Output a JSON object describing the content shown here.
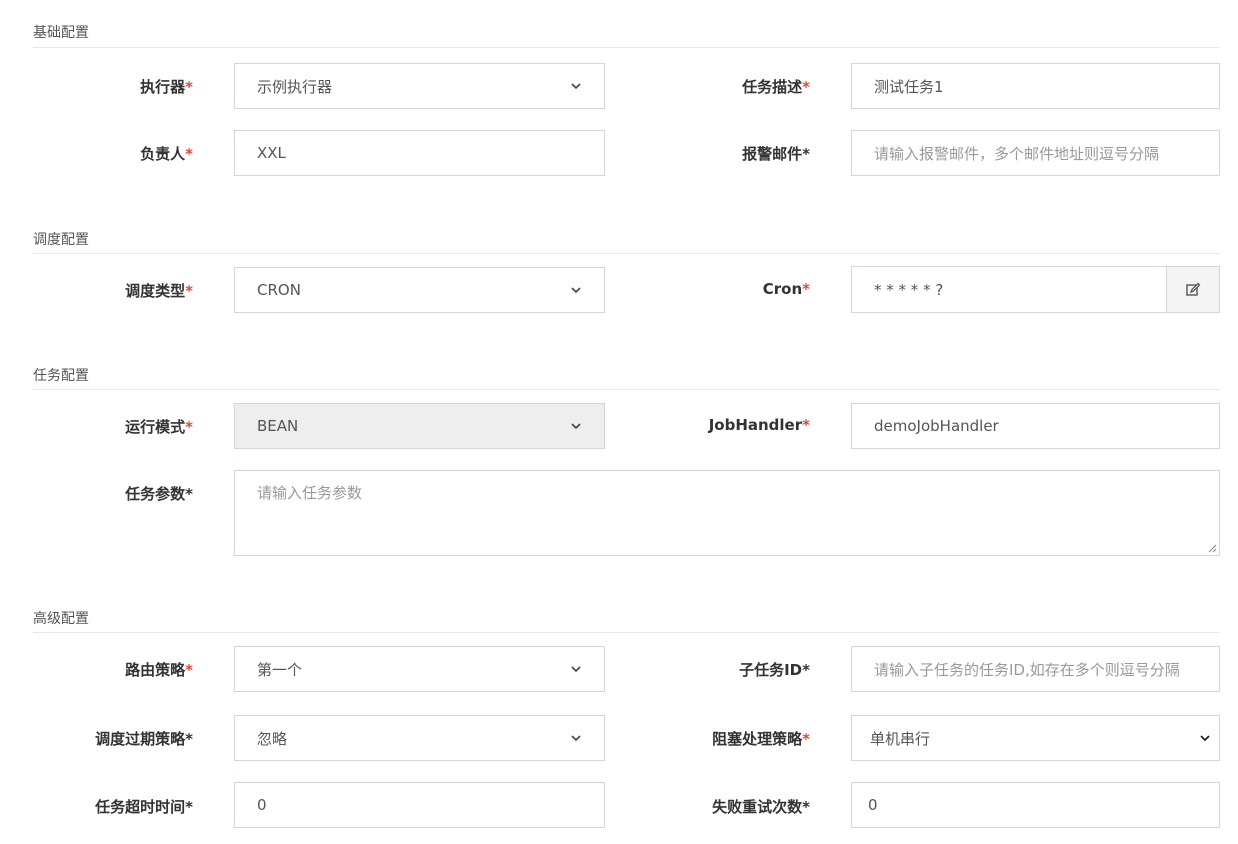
{
  "sections": {
    "basic": "基础配置",
    "schedule": "调度配置",
    "job": "任务配置",
    "advanced": "高级配置"
  },
  "fields": {
    "executor": {
      "label": "执行器",
      "value": "示例执行器"
    },
    "job_desc": {
      "label": "任务描述",
      "value": "测试任务1"
    },
    "author": {
      "label": "负责人",
      "value": "XXL"
    },
    "alarm_email": {
      "label": "报警邮件",
      "placeholder": "请输入报警邮件，多个邮件地址则逗号分隔"
    },
    "schedule_type": {
      "label": "调度类型",
      "value": "CRON"
    },
    "cron": {
      "label": "Cron",
      "value": "* * * * * ?"
    },
    "glue_type": {
      "label": "运行模式",
      "value": "BEAN"
    },
    "job_handler": {
      "label": "JobHandler",
      "value": "demoJobHandler"
    },
    "job_param": {
      "label": "任务参数",
      "placeholder": "请输入任务参数"
    },
    "route_strategy": {
      "label": "路由策略",
      "value": "第一个"
    },
    "child_job_id": {
      "label": "子任务ID",
      "placeholder": "请输入子任务的任务ID,如存在多个则逗号分隔"
    },
    "misfire_strategy": {
      "label": "调度过期策略",
      "value": "忽略"
    },
    "block_strategy": {
      "label": "阻塞处理策略",
      "value": "单机串行"
    },
    "timeout": {
      "label": "任务超时时间",
      "value": "0"
    },
    "fail_retry": {
      "label": "失败重试次数",
      "value": "0"
    }
  },
  "required_mark": "*",
  "colors": {
    "required": "#dd4b39",
    "border": "#d2d6de",
    "disabled_bg": "#eeeeee"
  },
  "icons": {
    "select": "chevron-down-icon",
    "cron_edit": "edit-icon",
    "textarea": "resize-grip-icon"
  }
}
